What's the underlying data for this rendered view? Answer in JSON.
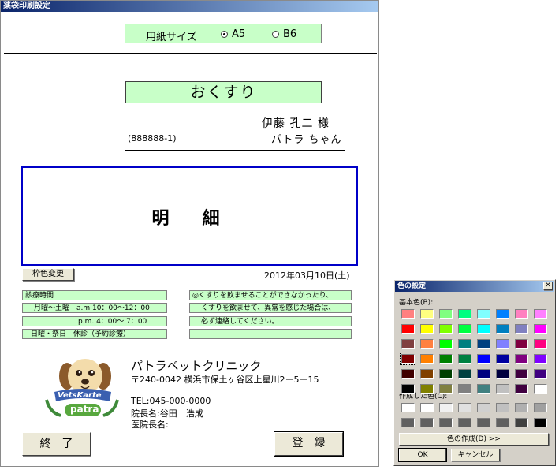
{
  "window": {
    "title": "薬袋印刷設定"
  },
  "paper": {
    "label": "用紙サイズ",
    "options": [
      "A5",
      "B6"
    ],
    "selected": "A5"
  },
  "header": {
    "title": "おくすり",
    "owner": "伊藤 孔二 様",
    "id": "(888888-1)",
    "pet": "パトラ ちゃん"
  },
  "detail": {
    "label": "明　細"
  },
  "frame_color_button": "枠色変更",
  "date": "2012年03月10日(土)",
  "hours": {
    "title": "診療時間",
    "weekday_am": "月曜～土曜　a.m.10：00～12：00",
    "weekday_pm": "p.m. 4：00～ 7：00",
    "holiday": "日曜・祭日　休診（予約診療）"
  },
  "notice": {
    "line1": "◎くすりを飲ませることができなかったり、",
    "line2": "くすりを飲ませて、異常を感じた場合は、",
    "line3": "必ず連絡してください。",
    "line4": ""
  },
  "clinic": {
    "name": "パトラペットクリニック",
    "address": "〒240-0042 横浜市保土ヶ谷区上星川2－5－15",
    "tel": "TEL:045-000-0000",
    "director": "院長名:谷田　浩成",
    "doctor": "医院長名:",
    "logo_text": "VetsKarte",
    "logo_brand": "patra"
  },
  "buttons": {
    "close": "終　了",
    "register": "登　録"
  },
  "color_dialog": {
    "title": "色の設定",
    "close_icon": "close-icon",
    "basic_label": "基本色(B):",
    "custom_label": "作成した色(C):",
    "define_button": "色の作成(D) >>",
    "ok_button": "OK",
    "cancel_button": "キャンセル",
    "basic_colors": [
      [
        "#ff8080",
        "#ffff80",
        "#80ff80",
        "#00ff80",
        "#80ffff",
        "#0080ff",
        "#ff80c0",
        "#ff80ff"
      ],
      [
        "#ff0000",
        "#ffff00",
        "#80ff00",
        "#00ff40",
        "#00ffff",
        "#0080c0",
        "#8080c0",
        "#ff00ff"
      ],
      [
        "#804040",
        "#ff8040",
        "#00ff00",
        "#008080",
        "#004080",
        "#8080ff",
        "#800040",
        "#ff0080"
      ],
      [
        "#800000",
        "#ff8000",
        "#008000",
        "#008040",
        "#0000ff",
        "#0000a0",
        "#800080",
        "#8000ff"
      ],
      [
        "#400000",
        "#804000",
        "#004000",
        "#004040",
        "#000080",
        "#000040",
        "#400040",
        "#400080"
      ],
      [
        "#000000",
        "#808000",
        "#808040",
        "#808080",
        "#408080",
        "#c0c0c0",
        "#400040",
        "#ffffff"
      ]
    ],
    "selected_color": "#800000",
    "custom_colors": [
      [
        "#ffffff",
        "#ffffff",
        "#f0f0f0",
        "#e0e0e0",
        "#d0d0d0",
        "#c0c0c0",
        "#b0b0b0",
        "#a0a0a0"
      ],
      [
        "#606060",
        "#606060",
        "#606060",
        "#606060",
        "#606060",
        "#606060",
        "#404040",
        "#000000"
      ]
    ]
  }
}
